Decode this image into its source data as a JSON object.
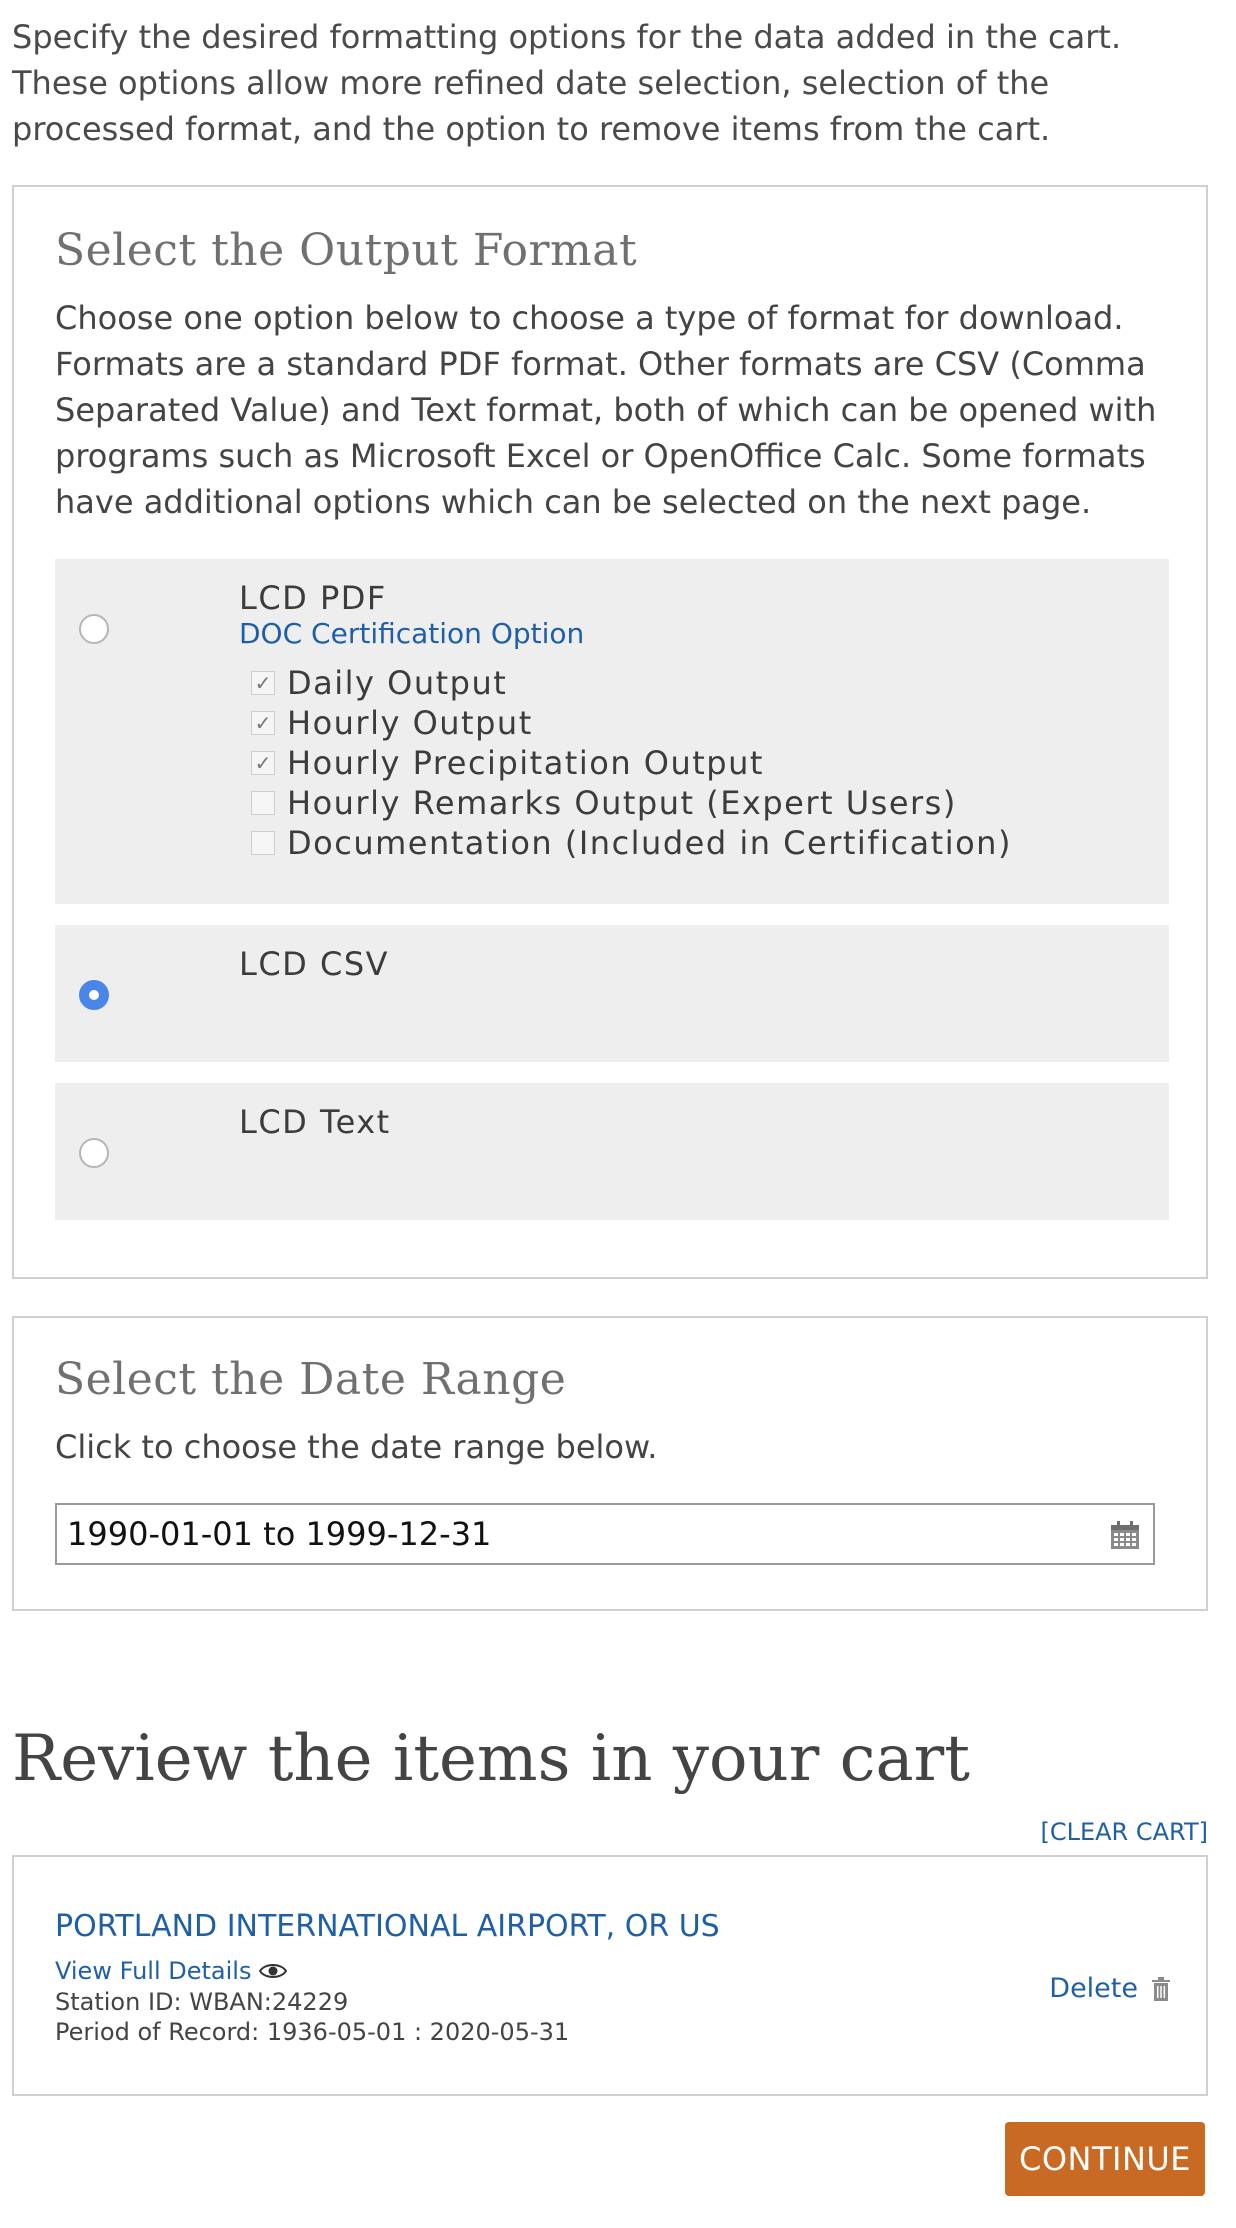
{
  "intro": "Specify the desired formatting options for the data added in the cart. These options allow more refined date selection, selection of the processed format, and the option to remove items from the cart.",
  "output_format": {
    "title": "Select the Output Format",
    "description": "Choose one option below to choose a type of format for download. Formats are a standard PDF format. Other formats are CSV (Comma Separated Value) and Text format, both of which can be opened with programs such as Microsoft Excel or OpenOffice Calc. Some formats have additional options which can be selected on the next page.",
    "options": [
      {
        "label": "LCD PDF",
        "selected": false,
        "cert_link": "DOC Certification Option",
        "checkboxes": [
          {
            "label": "Daily Output",
            "checked": true
          },
          {
            "label": "Hourly Output",
            "checked": true
          },
          {
            "label": "Hourly Precipitation Output",
            "checked": true
          },
          {
            "label": "Hourly Remarks Output (Expert Users)",
            "checked": false
          },
          {
            "label": "Documentation (Included in Certification)",
            "checked": false
          }
        ]
      },
      {
        "label": "LCD CSV",
        "selected": true
      },
      {
        "label": "LCD Text",
        "selected": false
      }
    ]
  },
  "date_range": {
    "title": "Select the Date Range",
    "description": "Click to choose the date range below.",
    "value": "1990-01-01 to 1999-12-31"
  },
  "cart": {
    "heading": "Review the items in your cart",
    "clear_label": "[CLEAR CART]",
    "item": {
      "station": "PORTLAND INTERNATIONAL AIRPORT, OR US",
      "view_details": "View Full Details",
      "station_id": "Station ID: WBAN:24229",
      "period": "Period of Record: 1936-05-01 : 2020-05-31",
      "delete_label": "Delete"
    }
  },
  "continue_label": "CONTINUE",
  "colors": {
    "link": "#1f5fa6",
    "continue": "#c96a24",
    "radio_selected": "#4a86e8"
  }
}
